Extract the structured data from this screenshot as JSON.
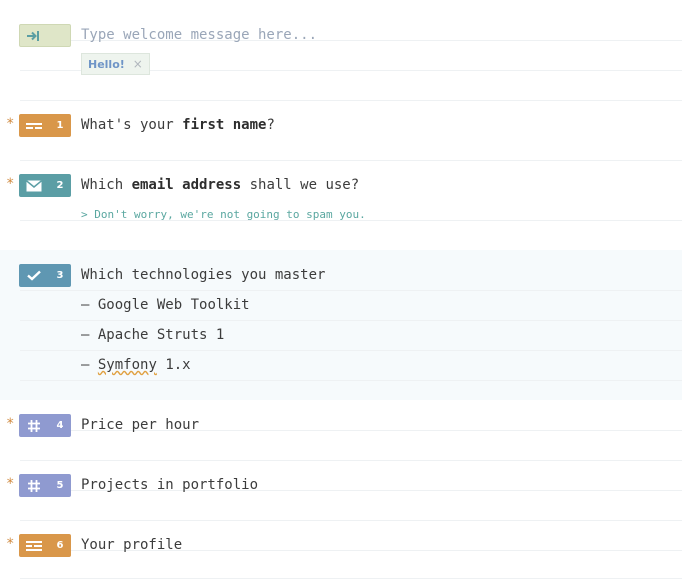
{
  "welcome": {
    "placeholder": "Type welcome message here...",
    "chip_label": "Hello!",
    "chip_remove": "×",
    "icon": "enter-arrow-icon",
    "color": "#dfe6c8"
  },
  "questions": [
    {
      "number": "1",
      "required": "*",
      "icon": "short-text-icon",
      "color": "#d9974a",
      "text_before": "What's your ",
      "text_bold": "first name",
      "text_after": "?"
    },
    {
      "number": "2",
      "required": "*",
      "icon": "envelope-icon",
      "color": "#5b9ea5",
      "text_before": "Which ",
      "text_bold": "email address",
      "text_after": " shall we use?",
      "description": "> Don't worry, we're not going to spam you."
    },
    {
      "number": "3",
      "icon": "checkmark-icon",
      "color": "#5f97b2",
      "text": "Which technologies you master",
      "options": [
        {
          "dash": "–",
          "label": "Google Web Toolkit"
        },
        {
          "dash": "–",
          "label": "Apache Struts 1"
        },
        {
          "dash": "–",
          "label_part1": "Symfony",
          "label_part2": " 1.x"
        }
      ]
    },
    {
      "number": "4",
      "required": "*",
      "icon": "hash-icon",
      "color": "#8f9ad0",
      "text": "Price per hour"
    },
    {
      "number": "5",
      "required": "*",
      "icon": "hash-icon",
      "color": "#8f9ad0",
      "text": "Projects in portfolio"
    },
    {
      "number": "6",
      "required": "*",
      "icon": "long-text-icon",
      "color": "#d9974a",
      "text": "Your profile"
    }
  ]
}
